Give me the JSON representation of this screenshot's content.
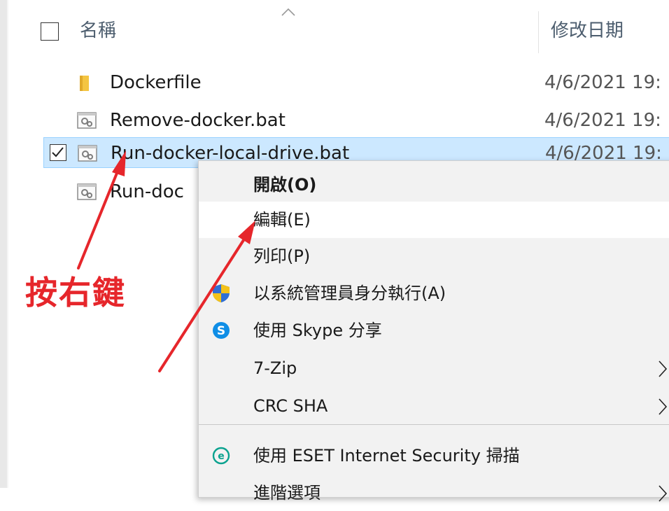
{
  "header": {
    "name_label": "名稱",
    "date_label": "修改日期"
  },
  "files": [
    {
      "name": "Dockerfile",
      "date": "4/6/2021 19:",
      "icon": "folder-icon"
    },
    {
      "name": "Remove-docker.bat",
      "date": "4/6/2021 19:",
      "icon": "batch-file-icon"
    },
    {
      "name": "Run-docker-local-drive.bat",
      "date": "4/6/2021 19:",
      "icon": "batch-file-icon",
      "selected": true
    },
    {
      "name": "Run-doc",
      "date": "",
      "icon": "batch-file-icon"
    }
  ],
  "context_menu": {
    "items": [
      {
        "label": "開啟(O)",
        "bold": true
      },
      {
        "label": "編輯(E)",
        "hover": true
      },
      {
        "label": "列印(P)"
      },
      {
        "label": "以系統管理員身分執行(A)",
        "icon": "uac-shield-icon"
      },
      {
        "label": "使用 Skype 分享",
        "icon": "skype-icon"
      },
      {
        "label": "7-Zip",
        "submenu": true
      },
      {
        "label": "CRC SHA",
        "submenu": true
      },
      {
        "label": "使用 ESET Internet Security 掃描",
        "icon": "eset-icon"
      },
      {
        "label": "進階選項",
        "submenu": true
      }
    ]
  },
  "annotation": {
    "text": "按右鍵",
    "color": "#e6262b"
  },
  "colors": {
    "selection_bg": "#cce8ff",
    "selection_border": "#99d1ff",
    "menu_bg": "#f2f2f2"
  }
}
